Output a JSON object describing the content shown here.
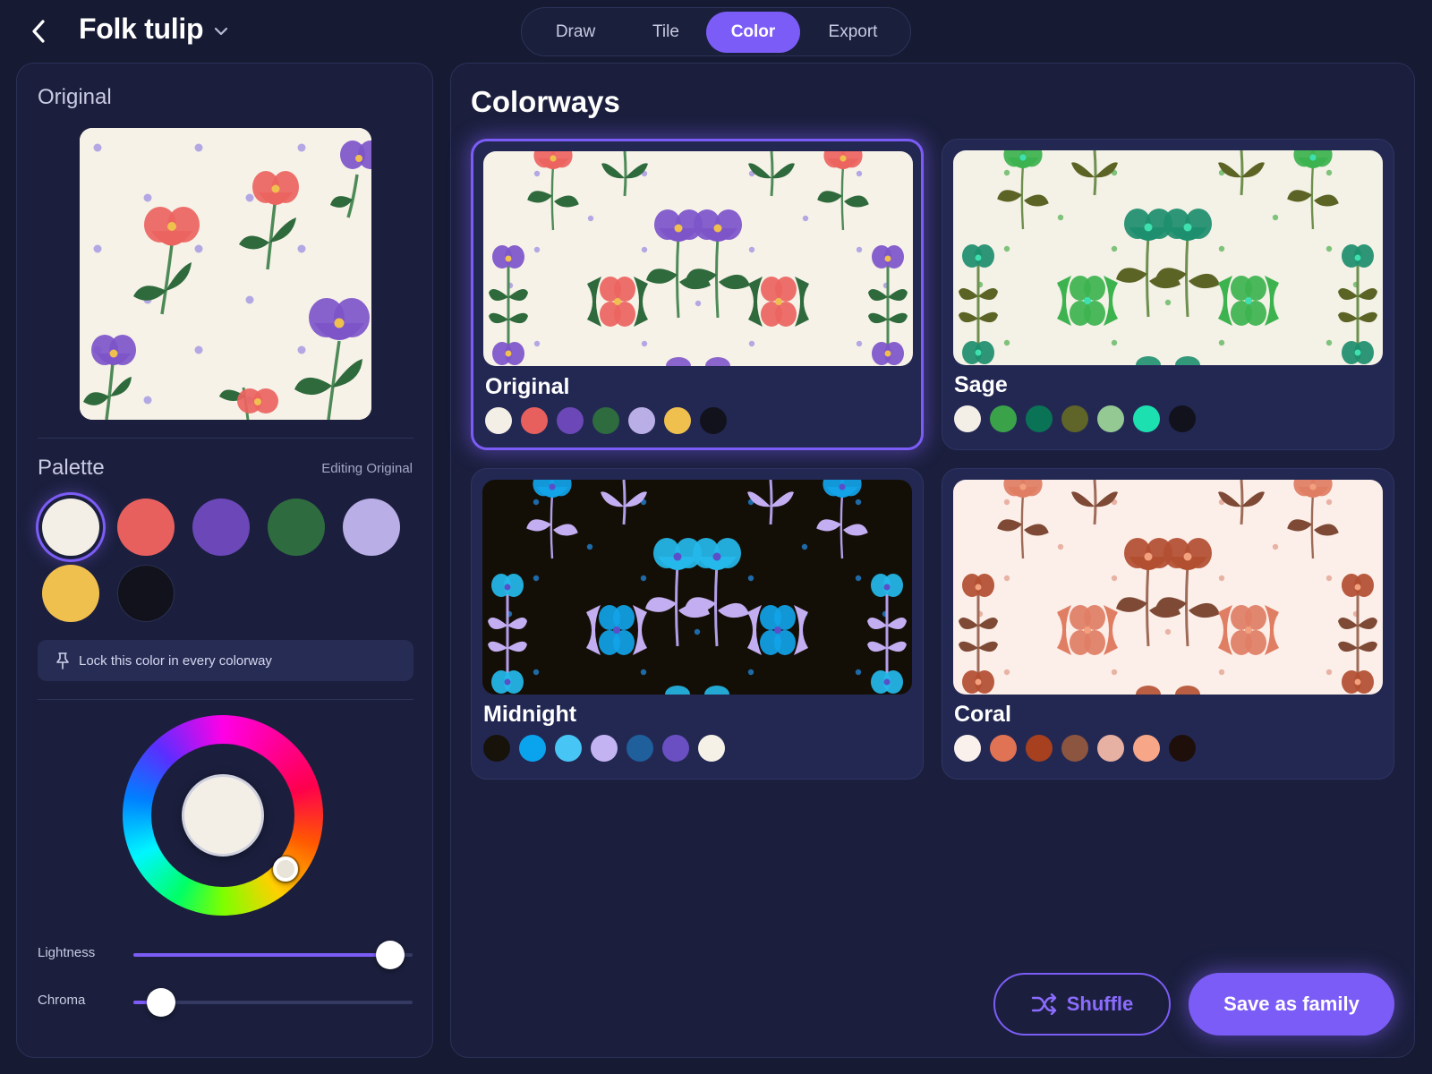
{
  "header": {
    "back_icon": "chevron-left-icon",
    "title": "Folk tulip",
    "title_caret_icon": "chevron-down-icon",
    "tabs": [
      {
        "label": "Draw"
      },
      {
        "label": "Tile"
      },
      {
        "label": "Color",
        "active": true
      },
      {
        "label": "Export"
      }
    ]
  },
  "left": {
    "original_title": "Original",
    "palette_title": "Palette",
    "editing_label": "Editing Original",
    "palette": [
      "#f3efe6",
      "#e8605e",
      "#6b47b8",
      "#2e6b3e",
      "#b9aee6",
      "#f0c04e",
      "#12121c"
    ],
    "selected_swatch_index": 0,
    "lock_icon": "pin-icon",
    "lock_label": "Lock this color in every colorway",
    "color_wheel_value": "#f3efe6",
    "sliders": {
      "lightness": {
        "label": "Lightness",
        "value": 0.92
      },
      "chroma": {
        "label": "Chroma",
        "value": 0.1
      }
    }
  },
  "main": {
    "title": "Colorways",
    "colorways": [
      {
        "name": "Original",
        "selected": true,
        "bg": "#f6f2e8",
        "flower": "#7d55c9",
        "flower_alt": "#ec6460",
        "leaf": "#2f6a3c",
        "leaf_light": "#2f6a3c",
        "stem": "#4e8a57",
        "dot": "#b3a8e3",
        "center": "#f0c04e",
        "swatches": [
          "#f3efe6",
          "#e8605e",
          "#6b47b8",
          "#2e6b3e",
          "#b9aee6",
          "#f0c04e",
          "#12121c"
        ]
      },
      {
        "name": "Sage",
        "selected": false,
        "bg": "#f4f1e6",
        "flower": "#1e8f6e",
        "flower_alt": "#3cb34f",
        "leaf": "#5b6425",
        "leaf_light": "#3cb34f",
        "stem": "#6e8f4e",
        "dot": "#7fc27a",
        "center": "#3ee0b0",
        "swatches": [
          "#f3efe6",
          "#3aa34a",
          "#0a7355",
          "#5f6428",
          "#94c994",
          "#1de0b0",
          "#12121c"
        ]
      },
      {
        "name": "Midnight",
        "selected": false,
        "bg": "#140f06",
        "flower": "#25b8ea",
        "flower_alt": "#12a3e8",
        "leaf": "#c3aef2",
        "leaf_light": "#c3aef2",
        "stem": "#b29ee8",
        "dot": "#1e6aa8",
        "center": "#5a4fc8",
        "swatches": [
          "#17120a",
          "#0aa4ee",
          "#47c5f5",
          "#c4b3f3",
          "#1f5f9c",
          "#6a4fc2",
          "#f5f1e6"
        ]
      },
      {
        "name": "Coral",
        "selected": false,
        "bg": "#fcefe9",
        "flower": "#b34f31",
        "flower_alt": "#e07e64",
        "leaf": "#7e4a36",
        "leaf_light": "#e07e64",
        "stem": "#9e6b58",
        "dot": "#e8b3a5",
        "center": "#f2a07e",
        "swatches": [
          "#faf1ec",
          "#e07354",
          "#a6401f",
          "#8c5540",
          "#e6b0a2",
          "#f7a688",
          "#1e0f0a"
        ]
      }
    ],
    "shuffle_icon": "shuffle-icon",
    "shuffle_label": "Shuffle",
    "save_label": "Save as family"
  }
}
